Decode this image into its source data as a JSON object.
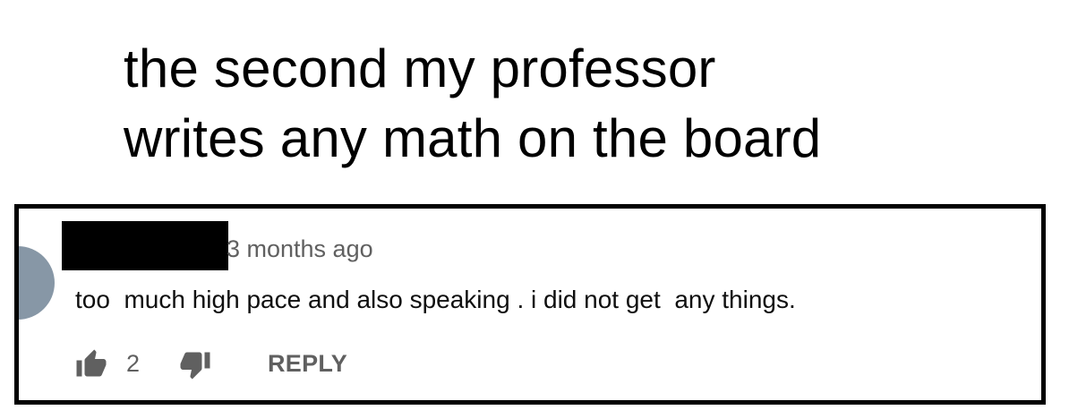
{
  "caption": {
    "line1": "the second my professor",
    "line2": "writes any math on the board"
  },
  "comment": {
    "timestamp": "3 months ago",
    "text": "too  much high pace and also speaking . i did not get  any things.",
    "like_count": "2",
    "reply_label": "REPLY"
  },
  "colors": {
    "avatar": "#8797a6",
    "secondary_text": "#606060",
    "frame_border": "#000000"
  },
  "icons": {
    "like": "thumbs-up-icon",
    "dislike": "thumbs-down-icon"
  }
}
